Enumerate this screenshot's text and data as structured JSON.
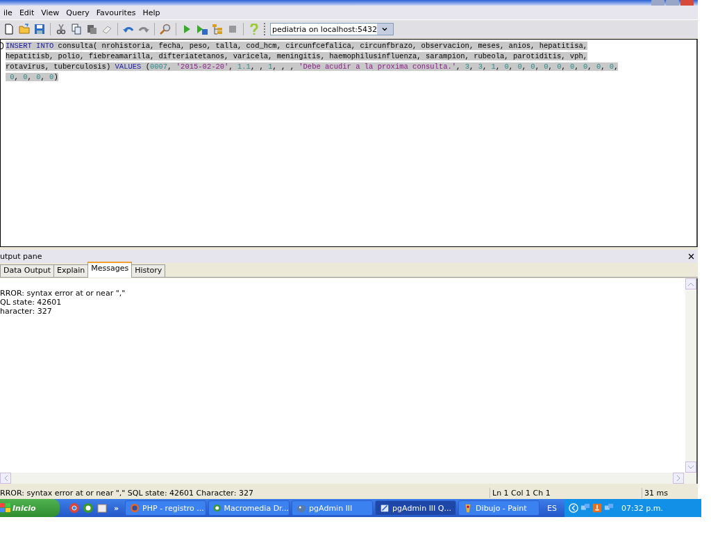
{
  "menu": [
    "ile",
    "Edit",
    "View",
    "Query",
    "Favourites",
    "Help"
  ],
  "toolbar": {
    "connection": "pediatria on localhost:5432"
  },
  "editor": {
    "selected": true,
    "lines": [
      [
        {
          "kind": "keyword",
          "text": "INSERT INTO"
        },
        {
          "kind": "plain",
          "text": " consulta( nrohistoria, fecha, peso, talla, cod_hcm, circunfcefalica, circunfbrazo, observacion, meses, anios, hepatitisa,"
        }
      ],
      [
        {
          "kind": "plain",
          "text": "hepatitisb, polio, fiebreamarilla, difteriatetanos, varicela, meningitis, haemophilusinfluenza, sarampion, rubeola, parotiditis, vph,"
        }
      ],
      [
        {
          "kind": "plain",
          "text": "rotavirus, tuberculosis) "
        },
        {
          "kind": "keyword",
          "text": "VALUES"
        },
        {
          "kind": "plain",
          "text": " ("
        },
        {
          "kind": "number",
          "text": "0007"
        },
        {
          "kind": "plain",
          "text": ", "
        },
        {
          "kind": "string",
          "text": "'2015-02-20'"
        },
        {
          "kind": "plain",
          "text": ", "
        },
        {
          "kind": "number",
          "text": "1.1"
        },
        {
          "kind": "plain",
          "text": ", , "
        },
        {
          "kind": "number",
          "text": "1"
        },
        {
          "kind": "plain",
          "text": ", , , "
        },
        {
          "kind": "string",
          "text": "'Debe acudir a la proxima consulta.'"
        },
        {
          "kind": "plain",
          "text": ", "
        },
        {
          "kind": "number",
          "text": "3"
        },
        {
          "kind": "plain",
          "text": ", "
        },
        {
          "kind": "number",
          "text": "3"
        },
        {
          "kind": "plain",
          "text": ", "
        },
        {
          "kind": "number",
          "text": "1"
        },
        {
          "kind": "plain",
          "text": ", "
        },
        {
          "kind": "number",
          "text": "0"
        },
        {
          "kind": "plain",
          "text": ", "
        },
        {
          "kind": "number",
          "text": "0"
        },
        {
          "kind": "plain",
          "text": ", "
        },
        {
          "kind": "number",
          "text": "0"
        },
        {
          "kind": "plain",
          "text": ", "
        },
        {
          "kind": "number",
          "text": "0"
        },
        {
          "kind": "plain",
          "text": ", "
        },
        {
          "kind": "number",
          "text": "0"
        },
        {
          "kind": "plain",
          "text": ", "
        },
        {
          "kind": "number",
          "text": "0"
        },
        {
          "kind": "plain",
          "text": ", "
        },
        {
          "kind": "number",
          "text": "0"
        },
        {
          "kind": "plain",
          "text": ", "
        },
        {
          "kind": "number",
          "text": "0"
        },
        {
          "kind": "plain",
          "text": ", "
        },
        {
          "kind": "number",
          "text": "0"
        },
        {
          "kind": "plain",
          "text": ","
        }
      ],
      [
        {
          "kind": "number",
          "text": " 0"
        },
        {
          "kind": "plain",
          "text": ", "
        },
        {
          "kind": "number",
          "text": "0"
        },
        {
          "kind": "plain",
          "text": ", "
        },
        {
          "kind": "number",
          "text": "0"
        },
        {
          "kind": "plain",
          "text": ", "
        },
        {
          "kind": "number",
          "text": "0"
        },
        {
          "kind": "plain",
          "text": ")"
        }
      ]
    ]
  },
  "output": {
    "title": "utput pane",
    "tabs": [
      {
        "label": "Data Output",
        "selected": false
      },
      {
        "label": "Explain",
        "selected": false
      },
      {
        "label": "Messages",
        "selected": true
      },
      {
        "label": "History",
        "selected": false
      }
    ],
    "messages": [
      "RROR: syntax error at or near \",\"",
      "QL state: 42601",
      "haracter: 327"
    ]
  },
  "status_bar": {
    "message": "RROR: syntax error at or near \",\" SQL state: 42601 Character: 327",
    "position": "Ln 1 Col 1 Ch 1",
    "time": "31 ms"
  },
  "taskbar": {
    "start": "Inicio",
    "more": "»",
    "tasks": [
      {
        "label": "PHP - registro ...",
        "selected": false
      },
      {
        "label": "Macromedia Dr...",
        "selected": false
      },
      {
        "label": "pgAdmin III",
        "selected": false
      },
      {
        "label": "pgAdmin III Q...",
        "selected": true
      },
      {
        "label": "Dibujo - Paint",
        "selected": false
      }
    ],
    "language": "ES",
    "clock": "07:32 p.m."
  }
}
